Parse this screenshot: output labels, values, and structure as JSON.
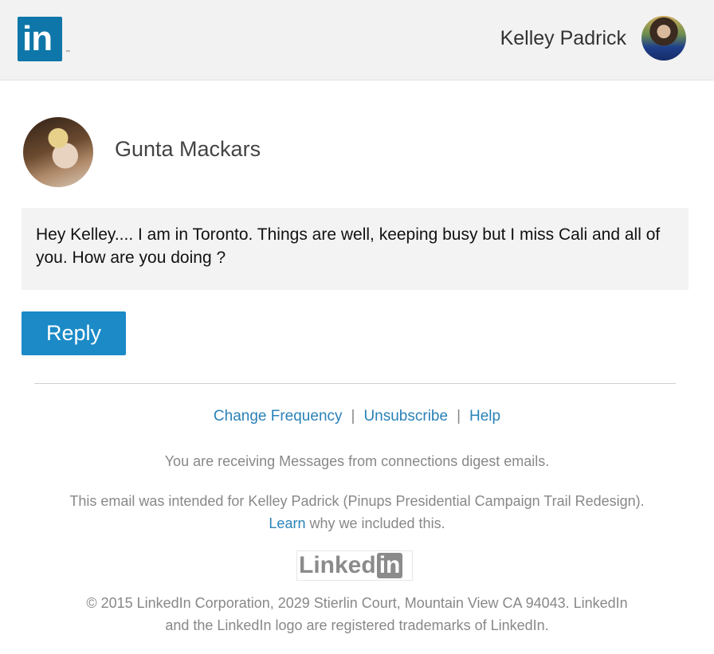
{
  "header": {
    "logo_text": "in",
    "logo_tm": "™",
    "recipient_name": "Kelley Padrick",
    "brand_color": "#0e76a8"
  },
  "message": {
    "sender_name": "Gunta Mackars",
    "body": "Hey Kelley.... I am in Toronto. Things are well, keeping busy but I miss Cali and all of you. How are you doing ?",
    "reply_label": "Reply",
    "reply_color": "#1b8ac7"
  },
  "footer": {
    "links": [
      "Change Frequency",
      "Unsubscribe",
      "Help"
    ],
    "separator": "|",
    "digest_notice": "You are receiving Messages from connections digest emails.",
    "intended_prefix": "This email was intended for Kelley Padrick (Pinups Presidential Campaign Trail Redesign).",
    "learn_label": "Learn",
    "intended_suffix": "why we included this.",
    "wordmark_linked": "Linked",
    "wordmark_in": "in",
    "copyright_line1": "© 2015 LinkedIn Corporation, 2029 Stierlin Court, Mountain View CA 94043. LinkedIn",
    "copyright_line2": "and the LinkedIn logo are registered trademarks of LinkedIn.",
    "link_color": "#2a82b8"
  },
  "icons": [
    "linkedin-logo-icon",
    "recipient-avatar",
    "sender-avatar",
    "linkedin-wordmark-logo"
  ]
}
